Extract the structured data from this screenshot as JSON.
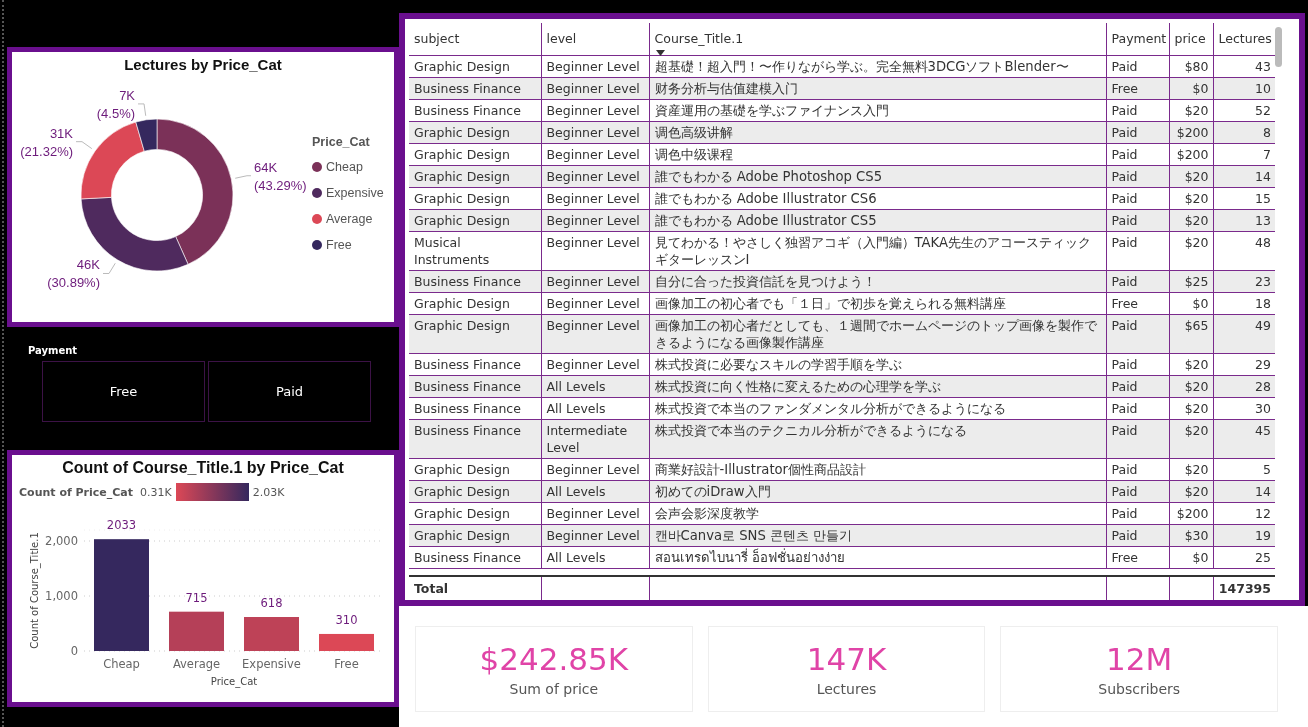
{
  "donut_card": {
    "title": "Lectures by Price_Cat",
    "legend_title": "Price_Cat",
    "chart_data": {
      "type": "donut",
      "categories": [
        "Cheap",
        "Expensive",
        "Average",
        "Free"
      ],
      "values": [
        43.29,
        30.89,
        21.32,
        4.5
      ],
      "colors": [
        "#7b3158",
        "#4f2a5e",
        "#dc4856",
        "#35285e"
      ],
      "value_labels": [
        [
          "64K",
          "(43.29%)"
        ],
        [
          "46K",
          "(30.89%)"
        ],
        [
          "31K",
          "(21.32%)"
        ],
        [
          "7K",
          "(4.5%)"
        ]
      ]
    }
  },
  "payment_slicer": {
    "title": "Payment",
    "options": [
      {
        "label": "Free",
        "selected": false
      },
      {
        "label": "Paid",
        "selected": false
      }
    ]
  },
  "bar_card": {
    "title": "Count of Course_Title.1 by Price_Cat",
    "legend": {
      "title": "Count of Price_Cat",
      "min_label": "0.31K",
      "max_label": "2.03K"
    },
    "chart_data": {
      "type": "bar",
      "xlabel": "Price_Cat",
      "ylabel": "Count of Course_Title.1",
      "categories": [
        "Cheap",
        "Average",
        "Expensive",
        "Free"
      ],
      "values": [
        2033,
        715,
        618,
        310
      ],
      "ylim": [
        0,
        2200
      ],
      "yticks": [
        {
          "value": 0,
          "label": "0"
        },
        {
          "value": 1000,
          "label": "1,000"
        },
        {
          "value": 2000,
          "label": "2,000"
        }
      ],
      "value_labels": [
        "2033",
        "715",
        "618",
        "310"
      ]
    }
  },
  "table": {
    "columns": [
      {
        "label": "subject",
        "sorted": false
      },
      {
        "label": "level",
        "sorted": false
      },
      {
        "label": "Course_Title.1",
        "sorted": true
      },
      {
        "label": "Payment",
        "sorted": false
      },
      {
        "label": "price",
        "sorted": false
      },
      {
        "label": "Lectures",
        "sorted": false
      }
    ],
    "rows": [
      [
        "Graphic Design",
        "Beginner Level",
        "超基礎！超入門！〜作りながら学ぶ。完全無料3DCGソフトBlender〜",
        "Paid",
        "$80",
        "43"
      ],
      [
        "Business Finance",
        "Beginner Level",
        "财务分析与估值建模入门",
        "Free",
        "$0",
        "10"
      ],
      [
        "Business Finance",
        "Beginner Level",
        "資産運用の基礎を学ぶファイナンス入門",
        "Paid",
        "$20",
        "52"
      ],
      [
        "Graphic Design",
        "Beginner Level",
        "调色高级讲解",
        "Paid",
        "$200",
        "8"
      ],
      [
        "Graphic Design",
        "Beginner Level",
        "调色中级课程",
        "Paid",
        "$200",
        "7"
      ],
      [
        "Graphic Design",
        "Beginner Level",
        "誰でもわかる Adobe Photoshop CS5",
        "Paid",
        "$20",
        "14"
      ],
      [
        "Graphic Design",
        "Beginner Level",
        "誰でもわかる Adobe Illustrator CS6",
        "Paid",
        "$20",
        "15"
      ],
      [
        "Graphic Design",
        "Beginner Level",
        "誰でもわかる Adobe Illustrator CS5",
        "Paid",
        "$20",
        "13"
      ],
      [
        "Musical Instruments",
        "Beginner Level",
        "見てわかる！やさしく独習アコギ（入門編）TAKA先生のアコースティックギターレッスンI",
        "Paid",
        "$20",
        "48"
      ],
      [
        "Business Finance",
        "Beginner Level",
        "自分に合った投資信託を見つけよう！",
        "Paid",
        "$25",
        "23"
      ],
      [
        "Graphic Design",
        "Beginner Level",
        "画像加工の初心者でも「１日」で初歩を覚えられる無料講座",
        "Free",
        "$0",
        "18"
      ],
      [
        "Graphic Design",
        "Beginner Level",
        "画像加工の初心者だとしても、１週間でホームページのトップ画像を製作できるようになる画像製作講座",
        "Paid",
        "$65",
        "49"
      ],
      [
        "Business Finance",
        "Beginner Level",
        "株式投資に必要なスキルの学習手順を学ぶ",
        "Paid",
        "$20",
        "29"
      ],
      [
        "Business Finance",
        "All Levels",
        "株式投資に向く性格に変えるための心理学を学ぶ",
        "Paid",
        "$20",
        "28"
      ],
      [
        "Business Finance",
        "All Levels",
        "株式投資で本当のファンダメンタル分析ができるようになる",
        "Paid",
        "$20",
        "30"
      ],
      [
        "Business Finance",
        "Intermediate Level",
        "株式投資で本当のテクニカル分析ができるようになる",
        "Paid",
        "$20",
        "45"
      ],
      [
        "Graphic Design",
        "Beginner Level",
        "商業好設計-Illustrator個性商品設計",
        "Paid",
        "$20",
        "5"
      ],
      [
        "Graphic Design",
        "All Levels",
        "初めてのiDraw入門",
        "Paid",
        "$20",
        "14"
      ],
      [
        "Graphic Design",
        "Beginner Level",
        "会声会影深度教学",
        "Paid",
        "$200",
        "12"
      ],
      [
        "Graphic Design",
        "Beginner Level",
        "캔바Canva로 SNS 콘텐츠 만들기",
        "Paid",
        "$30",
        "19"
      ],
      [
        "Business Finance",
        "All Levels",
        "สอนเทรดไบนารี่ อ็อฟชั่นอย่างง่าย",
        "Free",
        "$0",
        "25"
      ]
    ],
    "total": {
      "label": "Total",
      "lectures": "147395"
    }
  },
  "kpis": [
    {
      "value": "$242.85K",
      "label": "Sum of price"
    },
    {
      "value": "147K",
      "label": "Lectures"
    },
    {
      "value": "12M",
      "label": "Subscribers"
    }
  ]
}
